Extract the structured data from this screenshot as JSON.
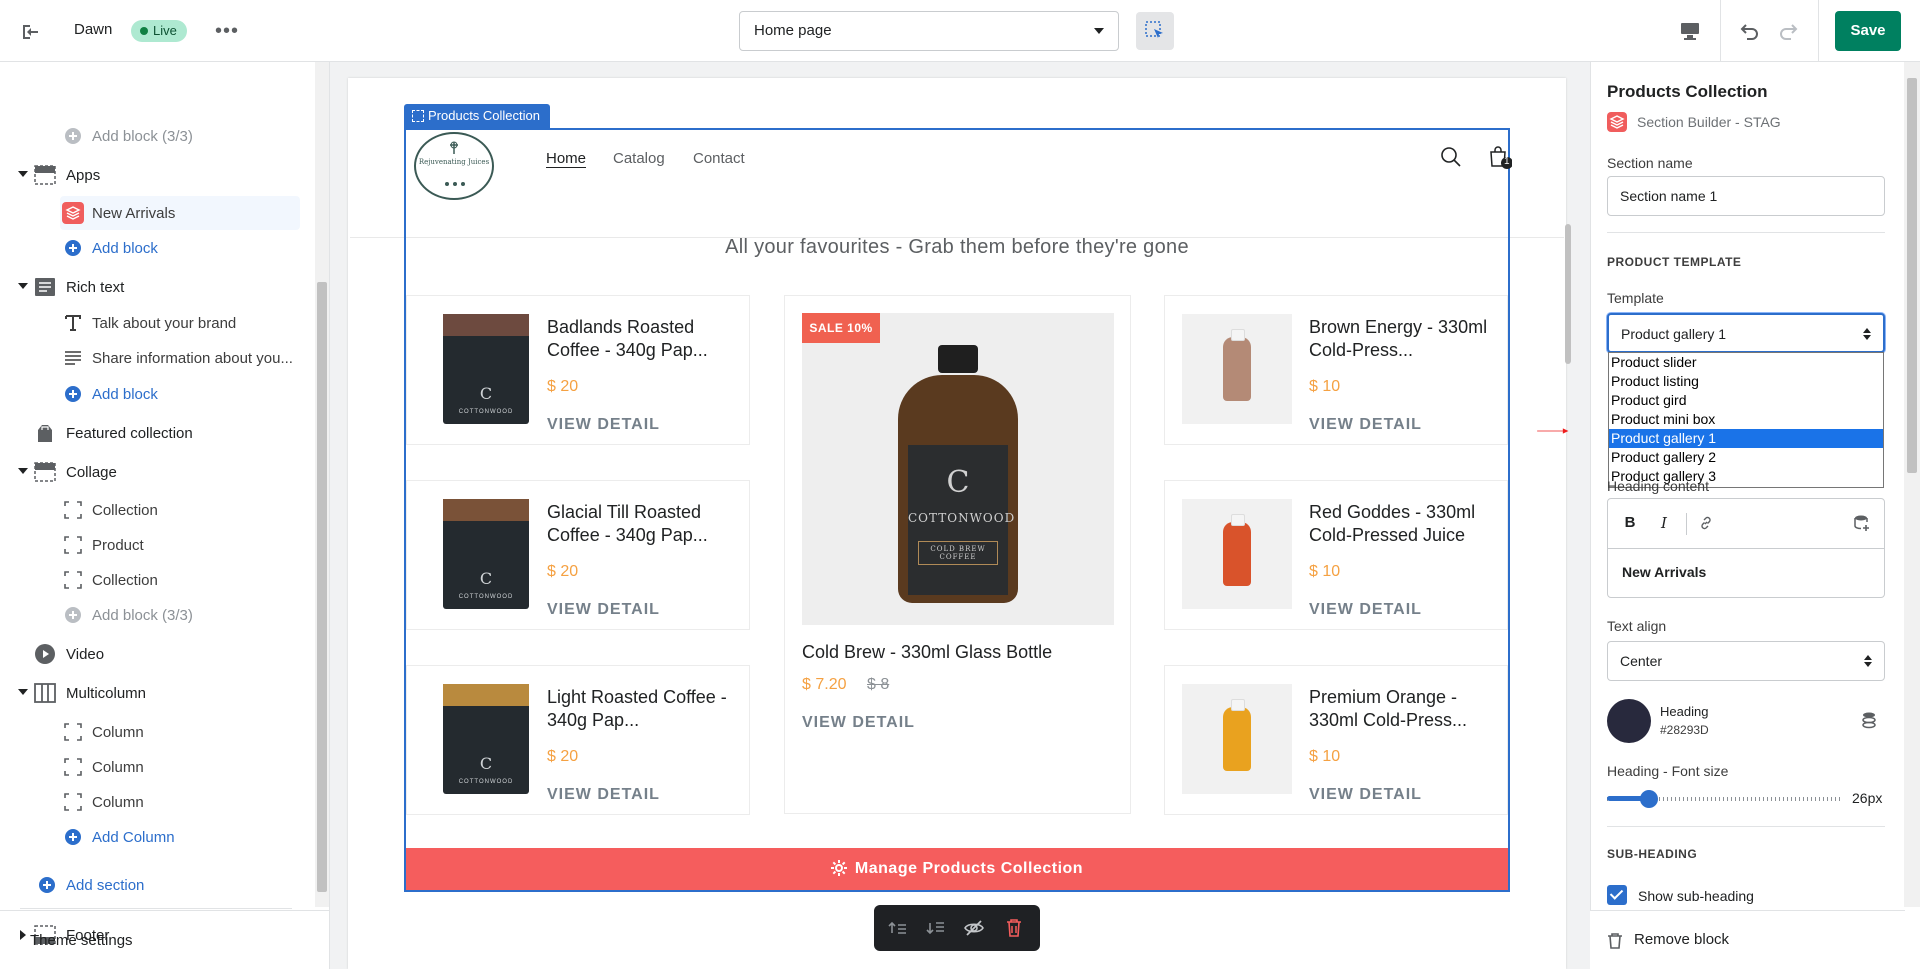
{
  "topbar": {
    "theme_name": "Dawn",
    "live_badge": "Live",
    "page_select": "Home page",
    "save_label": "Save"
  },
  "sidebar": {
    "rows": [
      {
        "label": "Add block (3/3)",
        "kind": "add-disabled"
      },
      {
        "label": "Apps",
        "kind": "section"
      },
      {
        "label": "New Arrivals",
        "kind": "app-block"
      },
      {
        "label": "Add block",
        "kind": "add"
      },
      {
        "label": "Rich text",
        "kind": "section"
      },
      {
        "label": "Talk about your brand",
        "kind": "text-block"
      },
      {
        "label": "Share information about you...",
        "kind": "para-block"
      },
      {
        "label": "Add block",
        "kind": "add"
      },
      {
        "label": "Featured collection",
        "kind": "section"
      },
      {
        "label": "Collage",
        "kind": "section"
      },
      {
        "label": "Collection",
        "kind": "block"
      },
      {
        "label": "Product",
        "kind": "block"
      },
      {
        "label": "Collection",
        "kind": "block"
      },
      {
        "label": "Add block (3/3)",
        "kind": "add-disabled"
      },
      {
        "label": "Video",
        "kind": "section"
      },
      {
        "label": "Multicolumn",
        "kind": "section"
      },
      {
        "label": "Column",
        "kind": "block"
      },
      {
        "label": "Column",
        "kind": "block"
      },
      {
        "label": "Column",
        "kind": "block"
      },
      {
        "label": "Add Column",
        "kind": "add"
      }
    ],
    "add_section": "Add section",
    "footer": "Footer",
    "theme_settings": "Theme settings"
  },
  "preview": {
    "section_label": "Products Collection",
    "logo_text": "Rejuvenating Juices",
    "nav": [
      "Home",
      "Catalog",
      "Contact"
    ],
    "cart_count": "1",
    "headline": "All your favourites - Grab them before they're gone",
    "left_products": [
      {
        "name": "Badlands Roasted Coffee - 340g Pap...",
        "price": "$ 20",
        "cta": "VIEW DETAIL",
        "brand": "COTTONWOOD"
      },
      {
        "name": "Glacial Till Roasted Coffee - 340g Pap...",
        "price": "$ 20",
        "cta": "VIEW DETAIL",
        "brand": "COTTONWOOD"
      },
      {
        "name": "Light Roasted Coffee - 340g Pap...",
        "price": "$ 20",
        "cta": "VIEW DETAIL",
        "brand": "COTTONWOOD"
      }
    ],
    "featured_product": {
      "badge": "SALE 10%",
      "name": "Cold Brew - 330ml Glass Bottle",
      "price": "$ 7.20",
      "compare_price": "$ 8",
      "cta": "VIEW DETAIL",
      "label_brand": "COTTONWOOD",
      "label_sub": "COLD BREW COFFEE"
    },
    "right_products": [
      {
        "name": "Brown Energy - 330ml Cold-Press...",
        "price": "$ 10",
        "cta": "VIEW DETAIL",
        "color": "#b48a76"
      },
      {
        "name": "Red Goddes - 330ml Cold-Pressed Juice",
        "price": "$ 10",
        "cta": "VIEW DETAIL",
        "color": "#d9532b"
      },
      {
        "name": "Premium Orange - 330ml Cold-Press...",
        "price": "$ 10",
        "cta": "VIEW DETAIL",
        "color": "#e9a21f"
      }
    ],
    "manage_button": "Manage Products Collection"
  },
  "panel": {
    "title": "Products Collection",
    "app_name": "Section Builder - STAG",
    "section_name_label": "Section name",
    "section_name_value": "Section name 1",
    "product_template_caps": "PRODUCT TEMPLATE",
    "template_label": "Template",
    "template_value": "Product gallery 1",
    "template_options": [
      "Product slider",
      "Product listing",
      "Product gird",
      "Product mini box",
      "Product gallery 1",
      "Product gallery 2",
      "Product gallery 3"
    ],
    "selected_option_index": 4,
    "heading_content_label": "Heading content",
    "heading_content_value": "New Arrivals",
    "text_align_label": "Text align",
    "text_align_value": "Center",
    "heading_color_label": "Heading",
    "heading_color_value": "#28293D",
    "font_size_label": "Heading - Font size",
    "font_size_value": "26px",
    "font_size_fraction": 0.18,
    "subheading_caps": "SUB-HEADING",
    "show_subheading_label": "Show sub-heading",
    "remove_block": "Remove block"
  },
  "colors": {
    "accent": "#2c6ecb",
    "save": "#008060",
    "manage": "#f55d5d",
    "price": "#f5a142",
    "heading_swatch": "#28293d"
  }
}
